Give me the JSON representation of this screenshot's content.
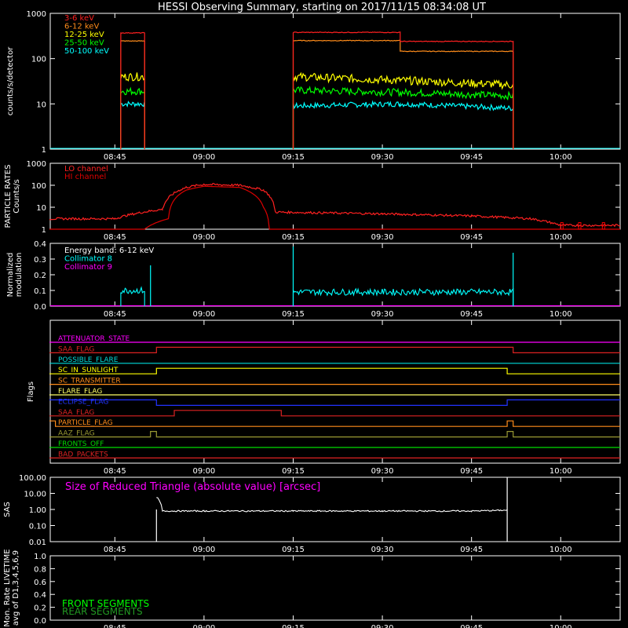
{
  "title": "HESSI Observing Summary, starting on 2017/11/15 08:34:08 UT",
  "time_ticks": [
    "08:45",
    "09:00",
    "09:15",
    "09:30",
    "09:45",
    "10:00"
  ],
  "colors": {
    "background": "#000000",
    "axes": "#ffffff",
    "red": "#ff0000",
    "orange": "#ff8c1a",
    "yellow": "#ffff00",
    "green": "#00ff00",
    "cyan": "#00ffff",
    "magenta": "#ff00ff",
    "blue": "#0000ff",
    "olive": "#999933",
    "darkgreen": "#229922"
  },
  "chart_data": [
    {
      "type": "line",
      "panel": "count-rates",
      "ylabel": "counts/s/detector",
      "yscale": "log",
      "ylim": [
        1,
        1000
      ],
      "ytick_labels": [
        "1",
        "10",
        "100",
        "1000"
      ],
      "legend": [
        "3-6 keV",
        "6-12 keV",
        "12-25 keV",
        "25-50 keV",
        "50-100 keV"
      ],
      "series": [
        {
          "name": "3-6 keV",
          "color": "#ff2020",
          "segments": [
            {
              "x": [
                "08:46",
                "08:50"
              ],
              "y": [
                370,
                370
              ]
            },
            {
              "x": [
                "09:15",
                "09:33",
                "09:33",
                "09:52"
              ],
              "y": [
                380,
                380,
                240,
                240
              ]
            }
          ]
        },
        {
          "name": "6-12 keV",
          "color": "#ff8c1a",
          "segments": [
            {
              "x": [
                "08:46",
                "08:50"
              ],
              "y": [
                245,
                245
              ]
            },
            {
              "x": [
                "09:15",
                "09:33",
                "09:33",
                "09:52"
              ],
              "y": [
                250,
                250,
                145,
                145
              ]
            }
          ]
        },
        {
          "name": "12-25 keV",
          "color": "#ffff00",
          "segments": [
            {
              "x": [
                "08:46",
                "08:50"
              ],
              "y": [
                40,
                40
              ]
            },
            {
              "x": [
                "09:15",
                "09:33",
                "09:52"
              ],
              "y": [
                40,
                33,
                26
              ]
            }
          ]
        },
        {
          "name": "25-50 keV",
          "color": "#00ff00",
          "segments": [
            {
              "x": [
                "08:46",
                "08:50"
              ],
              "y": [
                19,
                19
              ]
            },
            {
              "x": [
                "09:15",
                "09:33",
                "09:52"
              ],
              "y": [
                20,
                18,
                15
              ]
            }
          ]
        },
        {
          "name": "50-100 keV",
          "color": "#00ffff",
          "segments": [
            {
              "x": [
                "08:46",
                "08:50"
              ],
              "y": [
                10,
                10
              ]
            },
            {
              "x": [
                "09:15",
                "09:33",
                "09:52"
              ],
              "y": [
                9,
                10,
                8
              ]
            }
          ]
        }
      ]
    },
    {
      "type": "line",
      "panel": "particle-rates",
      "ylabel": "PARTICLE RATES",
      "ylabel2": "Counts/s",
      "yscale": "log",
      "ylim": [
        1,
        1000
      ],
      "ytick_labels": [
        "1",
        "10",
        "100",
        "1000"
      ],
      "legend": [
        "LO channel",
        "HI channel"
      ],
      "series": [
        {
          "name": "LO channel",
          "color": "#ff2020",
          "x": [
            "08:34",
            "08:45",
            "08:53",
            "08:57",
            "09:00",
            "09:06",
            "09:10",
            "09:12",
            "09:30",
            "09:45",
            "09:55",
            "10:00",
            "10:10"
          ],
          "y": [
            3,
            3,
            8,
            80,
            110,
            100,
            60,
            6,
            5,
            4,
            3,
            1.5,
            1.5
          ]
        },
        {
          "name": "HI channel",
          "color": "#dd0000",
          "x": [
            "08:34",
            "08:50",
            "08:54",
            "08:57",
            "09:00",
            "09:06",
            "09:10",
            "09:11",
            "10:10"
          ],
          "y": [
            1,
            1,
            3,
            60,
            90,
            80,
            10,
            1,
            1
          ]
        }
      ]
    },
    {
      "type": "line",
      "panel": "modulation",
      "ylabel": "Normalized",
      "ylabel2": "modulation",
      "ylim": [
        0,
        0.4
      ],
      "ytick_labels": [
        "0.0",
        "0.1",
        "0.2",
        "0.3",
        "0.4"
      ],
      "legend": [
        "Energy band: 6-12 keV",
        "Collimator 8",
        "Collimator 9"
      ],
      "series": [
        {
          "name": "Collimator 8",
          "color": "#00ffff",
          "segments": [
            {
              "x": [
                "08:46",
                "08:50"
              ],
              "y": [
                0.1,
                0.1
              ]
            },
            {
              "x": [
                "09:15",
                "09:52"
              ],
              "y": [
                0.09,
                0.09
              ]
            }
          ],
          "spikes": [
            {
              "x": "08:51",
              "y": 0.26
            },
            {
              "x": "09:15",
              "y": 0.38
            },
            {
              "x": "09:52",
              "y": 0.34
            }
          ]
        },
        {
          "name": "Collimator 9",
          "color": "#ff00ff",
          "x": [
            "08:34",
            "10:10"
          ],
          "y": [
            0,
            0
          ]
        }
      ]
    },
    {
      "type": "line",
      "panel": "flags",
      "ylabel": "Flags",
      "series": [
        {
          "name": "ATTENUATOR_STATE",
          "color": "#ff00ff",
          "x": [
            "08:34",
            "10:10"
          ],
          "y": [
            0,
            0
          ]
        },
        {
          "name": "SAA_FLAG",
          "color": "#dd2222",
          "x": [
            "08:34",
            "08:52",
            "08:52",
            "09:52",
            "09:52",
            "10:10"
          ],
          "y": [
            0,
            0,
            1,
            1,
            0,
            0
          ]
        },
        {
          "name": "POSSIBLE_FLARE",
          "color": "#00dddd",
          "x": [
            "08:34",
            "10:10"
          ],
          "y": [
            0,
            0
          ]
        },
        {
          "name": "SC_IN_SUNLIGHT",
          "color": "#ffff00",
          "x": [
            "08:34",
            "08:52",
            "08:52",
            "09:51",
            "09:51",
            "10:10"
          ],
          "y": [
            0,
            0,
            1,
            1,
            0,
            0
          ]
        },
        {
          "name": "SC_TRANSMITTER",
          "color": "#ff8c1a",
          "x": [
            "08:34",
            "10:10"
          ],
          "y": [
            0,
            0
          ]
        },
        {
          "name": "FLARE_FLAG",
          "color": "#ffff66",
          "x": [
            "08:34",
            "10:10"
          ],
          "y": [
            0,
            0
          ]
        },
        {
          "name": "ECLIPSE_FLAG",
          "color": "#2233ff",
          "x": [
            "08:34",
            "08:52",
            "08:52",
            "09:51",
            "09:51",
            "10:10"
          ],
          "y": [
            1,
            1,
            0,
            0,
            1,
            1
          ]
        },
        {
          "name": "SAA_FLAG",
          "color": "#dd2222",
          "x": [
            "08:34",
            "08:55",
            "08:55",
            "09:13",
            "09:13",
            "10:10"
          ],
          "y": [
            0,
            0,
            1,
            1,
            0,
            0
          ]
        },
        {
          "name": "PARTICLE_FLAG",
          "color": "#ff8c1a",
          "x": [
            "08:34",
            "08:35",
            "08:35",
            "09:51",
            "09:51",
            "09:52",
            "09:52",
            "10:10"
          ],
          "y": [
            1,
            1,
            0,
            0,
            1,
            1,
            0,
            0
          ]
        },
        {
          "name": "AAZ_FLAG",
          "color": "#999933",
          "x": [
            "08:34",
            "08:51",
            "08:51",
            "08:52",
            "08:52",
            "09:51",
            "09:51",
            "09:52",
            "09:52",
            "10:10"
          ],
          "y": [
            0,
            0,
            1,
            1,
            0,
            0,
            1,
            1,
            0,
            0
          ]
        },
        {
          "name": "FRONTS_OFF",
          "color": "#00dd00",
          "x": [
            "08:34",
            "10:10"
          ],
          "y": [
            0,
            0
          ]
        },
        {
          "name": "BAD_PACKETS",
          "color": "#dd2222",
          "x": [
            "08:34",
            "10:10"
          ],
          "y": [
            0,
            0
          ]
        }
      ]
    },
    {
      "type": "line",
      "panel": "sas",
      "ylabel": "SAS",
      "yscale": "log",
      "ylim": [
        0.01,
        100
      ],
      "ytick_labels": [
        "0.01",
        "0.10",
        "1.00",
        "10.00",
        "100.00"
      ],
      "annotation": "Size of Reduced Triangle (absolute value) [arcsec]",
      "series": [
        {
          "name": "Size of Reduced Triangle",
          "color": "#ffffff",
          "x": [
            "08:52",
            "08:53",
            "09:00",
            "09:15",
            "09:30",
            "09:45",
            "09:51"
          ],
          "y": [
            6,
            0.8,
            0.8,
            0.8,
            0.8,
            0.8,
            0.9
          ],
          "spikes": [
            {
              "x": "08:52",
              "y": 0.01
            },
            {
              "x": "09:51",
              "y": 100
            },
            {
              "x": "09:51",
              "y": 0.01
            }
          ]
        }
      ]
    },
    {
      "type": "line",
      "panel": "livetime",
      "ylabel": "Mon. Rate LIVETIME",
      "ylabel2": "avg of D1,3,4,5,6,9",
      "ylim": [
        0,
        1
      ],
      "ytick_labels": [
        "0.0",
        "0.2",
        "0.4",
        "0.6",
        "0.8",
        "1.0"
      ],
      "legend": [
        "FRONT SEGMENTS",
        "REAR SEGMENTS"
      ],
      "series": []
    }
  ]
}
